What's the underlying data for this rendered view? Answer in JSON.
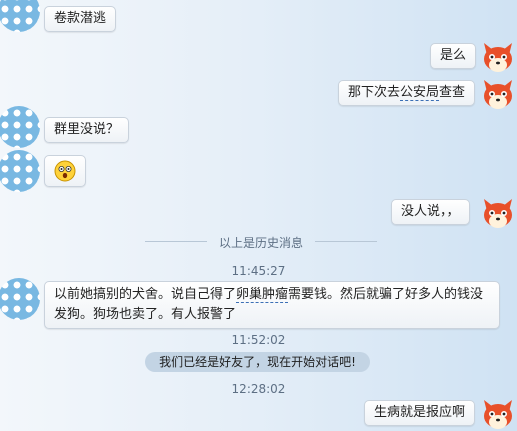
{
  "messages": {
    "m1": "卷款潜逃",
    "m2": "是么",
    "m3_pre": "那下次去",
    "m3_ul": "公安局",
    "m3_post": "查查",
    "m4": "群里没说？",
    "m6": "没人说，，",
    "m7_pre": "以前她搞别的犬舍。说自己得了",
    "m7_ul": "卵巢肿瘤",
    "m7_post": "需要钱。然后就骗了好多人的钱没发狗。狗场也卖了。有人报警了",
    "m8": "生病就是报应啊"
  },
  "history_divider": "以上是历史消息",
  "times": {
    "t1": "11:45:27",
    "t2": "11:52:02",
    "t3": "12:28:02"
  },
  "notice": "我们已经是好友了，现在开始对话吧!",
  "colors": {
    "avatar_blue": "#79b8e2",
    "fox_orange": "#e8502a"
  },
  "icons": {
    "contact_avatar": "blue-polka-dot-avatar",
    "self_avatar": "red-fox-avatar",
    "emoji": "shocked-face-emoji"
  }
}
